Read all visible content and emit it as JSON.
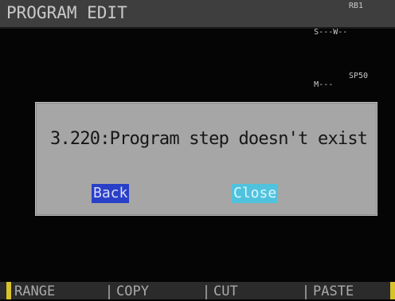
{
  "header": {
    "title": "PROGRAM EDIT",
    "status_line1_left": "S---W--",
    "status_line2_left": "M---",
    "status_line1_right": "RB1",
    "status_line2_right": "SP50"
  },
  "dialog": {
    "message": "3.220:Program step doesn't exist",
    "back_label": "Back",
    "close_label": "Close"
  },
  "function_keys": {
    "f1": "RANGE",
    "f2": "COPY",
    "f3": "CUT",
    "f4": "PASTE"
  },
  "colors": {
    "back_button_bg": "#2a3fc8",
    "close_button_bg": "#4fc3de",
    "dialog_bg": "#a6a6a6"
  }
}
